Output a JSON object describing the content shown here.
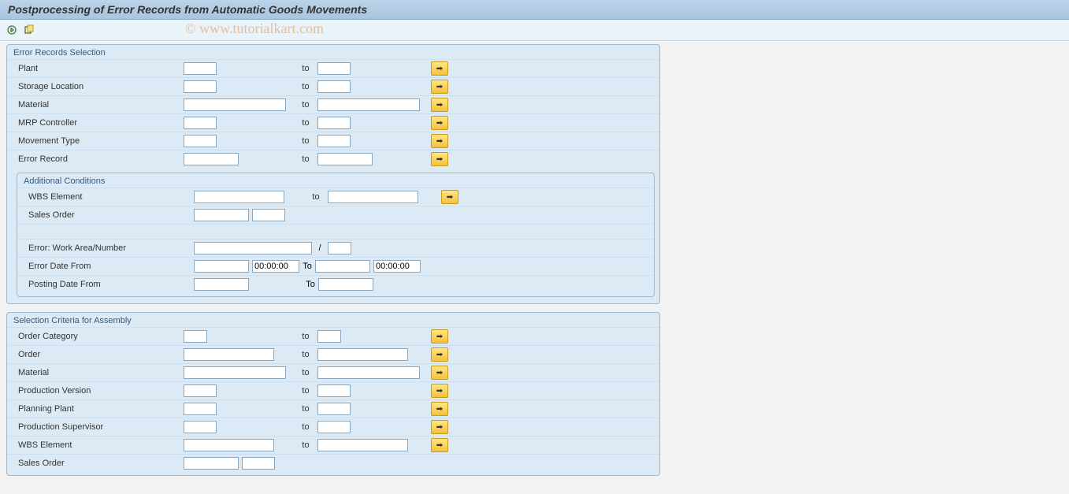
{
  "title": "Postprocessing of Error Records from Automatic Goods Movements",
  "watermark": "© www.tutorialkart.com",
  "to": "to",
  "To": "To",
  "slash": "/",
  "time_default": "00:00:00",
  "group1": {
    "title": "Error Records Selection",
    "plant": "Plant",
    "storage_location": "Storage Location",
    "material": "Material",
    "mrp_controller": "MRP Controller",
    "movement_type": "Movement Type",
    "error_record": "Error Record"
  },
  "group1a": {
    "title": "Additional Conditions",
    "wbs_element": "WBS Element",
    "sales_order": "Sales Order",
    "error_work": "Error: Work Area/Number",
    "error_date_from": "Error Date From",
    "posting_date_from": "Posting Date From"
  },
  "group2": {
    "title": "Selection Criteria for Assembly",
    "order_category": "Order Category",
    "order": "Order",
    "material": "Material",
    "production_version": "Production Version",
    "planning_plant": "Planning Plant",
    "production_supervisor": "Production Supervisor",
    "wbs_element": "WBS Element",
    "sales_order": "Sales Order"
  }
}
